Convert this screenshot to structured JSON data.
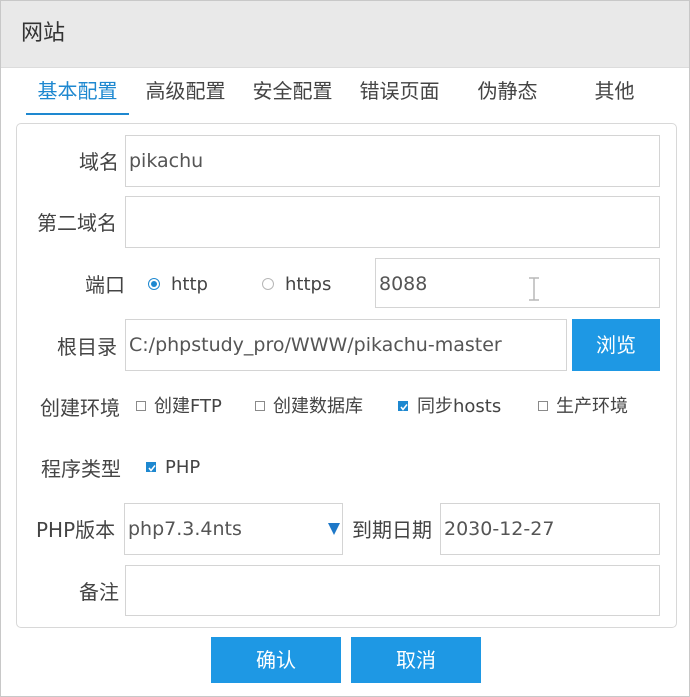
{
  "window": {
    "title": "网站"
  },
  "tabs": [
    {
      "label": "基本配置",
      "active": true
    },
    {
      "label": "高级配置"
    },
    {
      "label": "安全配置"
    },
    {
      "label": "错误页面"
    },
    {
      "label": "伪静态"
    },
    {
      "label": "其他"
    }
  ],
  "form": {
    "domain": {
      "label": "域名",
      "value": "pikachu"
    },
    "second_domain": {
      "label": "第二域名",
      "value": ""
    },
    "port": {
      "label": "端口",
      "protocol_http": "http",
      "protocol_https": "https",
      "selected": "http",
      "value": "8088"
    },
    "root": {
      "label": "根目录",
      "value": "C:/phpstudy_pro/WWW/pikachu-master",
      "browse_label": "浏览"
    },
    "env": {
      "label": "创建环境",
      "options": [
        {
          "label": "创建FTP",
          "checked": false
        },
        {
          "label": "创建数据库",
          "checked": false
        },
        {
          "label": "同步hosts",
          "checked": true
        },
        {
          "label": "生产环境",
          "checked": false
        }
      ]
    },
    "program_type": {
      "label": "程序类型",
      "option": "PHP",
      "checked": true
    },
    "php_version": {
      "label": "PHP版本",
      "value": "php7.3.4nts"
    },
    "expire": {
      "label": "到期日期",
      "value": "2030-12-27"
    },
    "note": {
      "label": "备注",
      "value": ""
    }
  },
  "footer": {
    "confirm_label": "确认",
    "cancel_label": "取消"
  },
  "colors": {
    "accent": "#1e98e4",
    "active_tab": "#1e88d0",
    "titlebar": "#e9e9e9"
  }
}
